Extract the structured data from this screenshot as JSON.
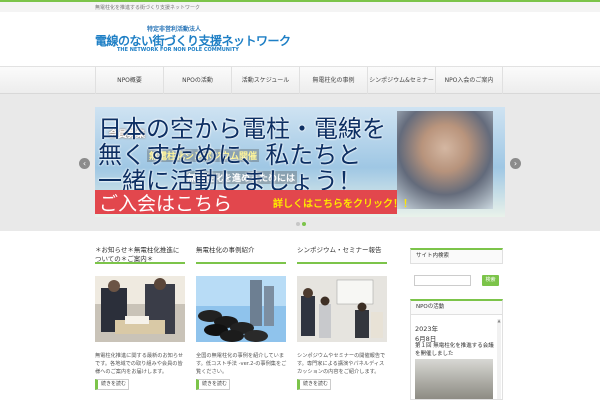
{
  "topbar": {
    "text": "無電柱化を推進する街づくり支援ネットワーク"
  },
  "logo": {
    "subtitle": "特定非営利活動法人",
    "main": "電線のない街づくり支援ネットワーク",
    "english": "THE NETWORK FOR NON POLE COMMUNITY"
  },
  "nav": {
    "items": [
      {
        "label": "NPO概要"
      },
      {
        "label": "NPOの活動"
      },
      {
        "label": "活動スケジュール"
      },
      {
        "label": "無電柱化の事例"
      },
      {
        "label": "シンポジウム&セミナー"
      },
      {
        "label": "NPO入会のご案内"
      }
    ]
  },
  "slider": {
    "line1": "日本の空から電柱・電線を",
    "line2": "無くすために、私たちと",
    "line3": "一緒に活動しましょう！",
    "ghost1": "会員募集",
    "ghost2": "無電柱化シンポジウム開催",
    "ghost3": "無電柱化を進めるためには",
    "join": "ご入会はこちら",
    "cta": "詳しくはこちらをクリック！！",
    "prev": "‹",
    "next": "›"
  },
  "columns": [
    {
      "title": "＊お知らせ＊無電柱化推進についての＊ご案内＊",
      "text": "無電柱化推進に関する最新のお知らせです。各地域での取り組みや会員の皆様へのご案内をお届けします。",
      "more": "続きを読む"
    },
    {
      "title": "無電柱化の事例紹介",
      "text": "全国の無電柱化の事例を紹介しています。低コスト手法 -ver.2-の事例集をご覧ください。",
      "more": "続きを読む"
    },
    {
      "title": "シンポジウム・セミナー報告",
      "text": "シンポジウムやセミナーの開催報告です。専門家による講演やパネルディスカッションの内容をご紹介します。",
      "more": "続きを読む"
    }
  ],
  "sidebar": {
    "search_head": "サイト内検索",
    "search_button": "検索",
    "news_head": "NPOの活動",
    "news_year": "2023年",
    "news_date": "6月8日",
    "news_title": "第１回 無電柱化を推進する会議を開催しました"
  },
  "colors": {
    "accent": "#7cc44a",
    "brand_blue": "#1e7fc5",
    "banner_red": "#e2474d"
  }
}
